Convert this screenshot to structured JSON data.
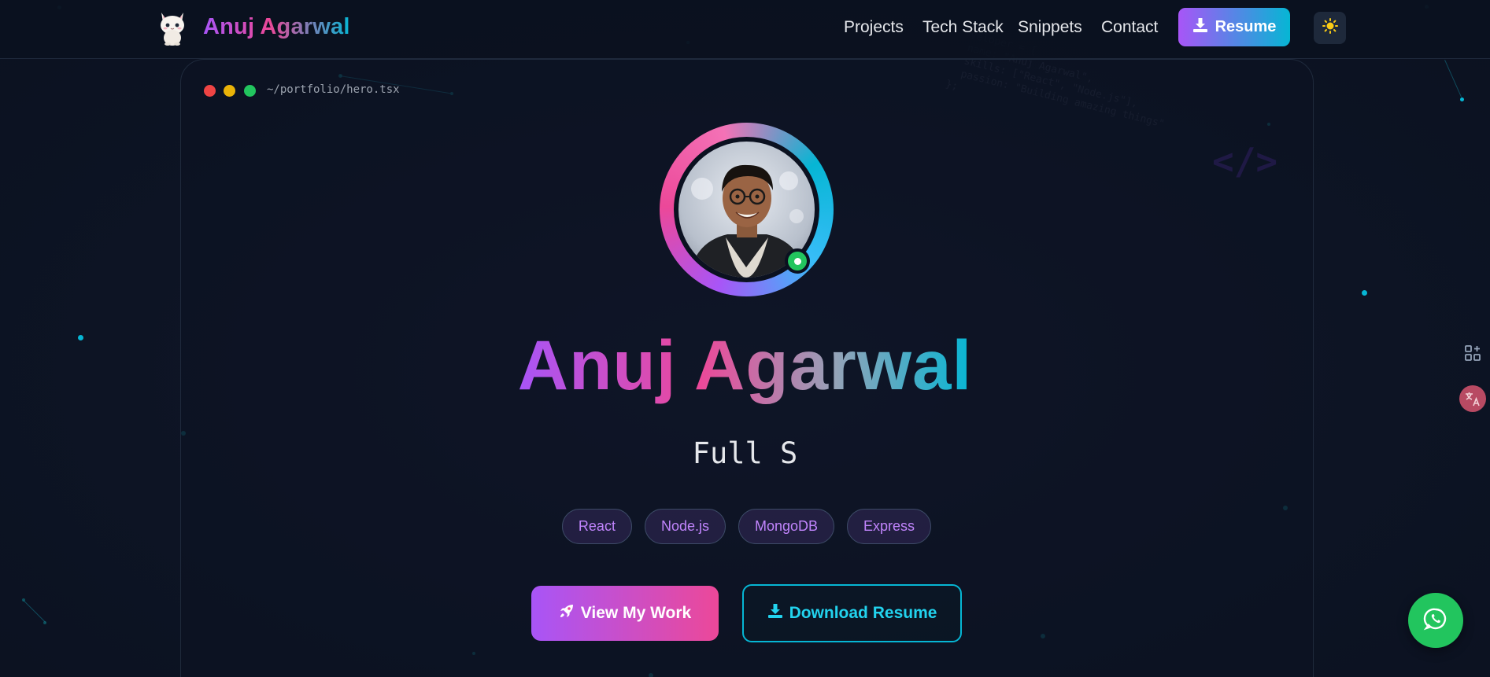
{
  "header": {
    "brand": "Anuj Agarwal",
    "nav": [
      "Projects",
      "Tech Stack",
      "Snippets",
      "Contact"
    ],
    "resume_label": "Resume",
    "theme_icon": "sun-icon"
  },
  "terminal": {
    "path": "~/portfolio/hero.tsx"
  },
  "background_code": {
    "lines": [
      "  veloper = {",
      "  name: \"Anuj Agarwal\",",
      "  skills: [\"React\", \"Node.js\"],",
      "  passion: \"Building amazing things\"",
      "};"
    ],
    "tag": "</>"
  },
  "hero": {
    "name": "Anuj Agarwal",
    "role": "Full S",
    "tags": [
      "React",
      "Node.js",
      "MongoDB",
      "Express"
    ],
    "primary_cta": "View My Work",
    "secondary_cta": "Download Resume"
  },
  "colors": {
    "background": "#0d1424",
    "accent_purple": "#a855f7",
    "accent_pink": "#ec4899",
    "accent_cyan": "#06b6d4",
    "online_green": "#22c55e"
  },
  "icons": {
    "logo": "cat-logo-icon",
    "resume": "download-icon",
    "view_work": "rocket-icon",
    "download": "download-icon",
    "side_tools": "grid-plus-icon",
    "translate": "translate-icon",
    "chat": "whatsapp-icon"
  }
}
